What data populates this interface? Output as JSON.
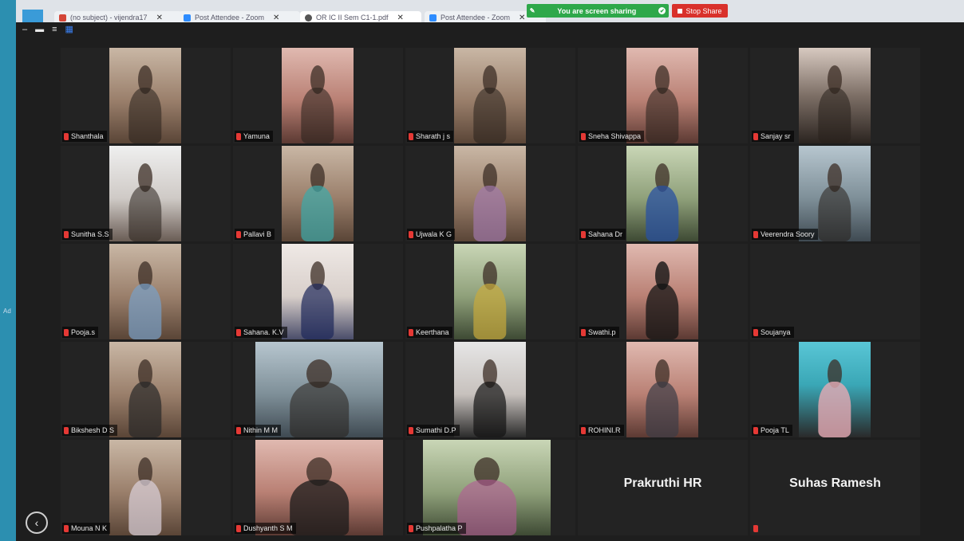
{
  "browser": {
    "tabs": [
      {
        "label": "(no subject) - vijendra17",
        "icon": "gmail-icon"
      },
      {
        "label": "Post Attendee - Zoom",
        "icon": "zoom-icon"
      },
      {
        "label": "OR IC II Sem C1-1.pdf",
        "icon": "pdf-icon"
      },
      {
        "label": "Post Attendee - Zoom",
        "icon": "zoom-icon"
      }
    ],
    "new_tab": "+"
  },
  "share_bar": {
    "status": "You are screen sharing",
    "stop_label": "Stop Share",
    "color": "#2ea84a",
    "stop_color": "#d9312b"
  },
  "left_edge": {
    "label": "Ad"
  },
  "participants": [
    {
      "name": "Shanthala",
      "video": true
    },
    {
      "name": "Yamuna",
      "video": true
    },
    {
      "name": "Sharath j s",
      "video": true
    },
    {
      "name": "Sneha Shivappa",
      "video": true
    },
    {
      "name": "Sanjay sr",
      "video": true
    },
    {
      "name": "Sunitha S.S",
      "video": true
    },
    {
      "name": "Pallavi B",
      "video": true
    },
    {
      "name": "Ujwala K G",
      "video": true
    },
    {
      "name": "Sahana Dr",
      "video": true
    },
    {
      "name": "Veerendra Soory",
      "video": true
    },
    {
      "name": "Pooja.s",
      "video": true
    },
    {
      "name": "Sahana. K.V",
      "video": true
    },
    {
      "name": "Keerthana",
      "video": true
    },
    {
      "name": "Swathi.p",
      "video": true
    },
    {
      "name": "Soujanya",
      "video": false
    },
    {
      "name": "Bikshesh D S",
      "video": true
    },
    {
      "name": "Nithin M M",
      "video": true
    },
    {
      "name": "Sumathi D.P",
      "video": true
    },
    {
      "name": "ROHINI.R",
      "video": true
    },
    {
      "name": "Pooja TL",
      "video": true
    },
    {
      "name": "Mouna N K",
      "video": true
    },
    {
      "name": "Dushyanth S M",
      "video": true
    },
    {
      "name": "Pushpalatha P",
      "video": true
    },
    {
      "name": "Prakruthi HR",
      "video": false,
      "display_name": "Prakruthi HR"
    },
    {
      "name": "",
      "video": false,
      "display_name": "Suhas Ramesh"
    }
  ],
  "controls": {
    "minimize": "–",
    "restore": "▬",
    "menu": "≡",
    "gallery": "▦",
    "back": "‹"
  }
}
